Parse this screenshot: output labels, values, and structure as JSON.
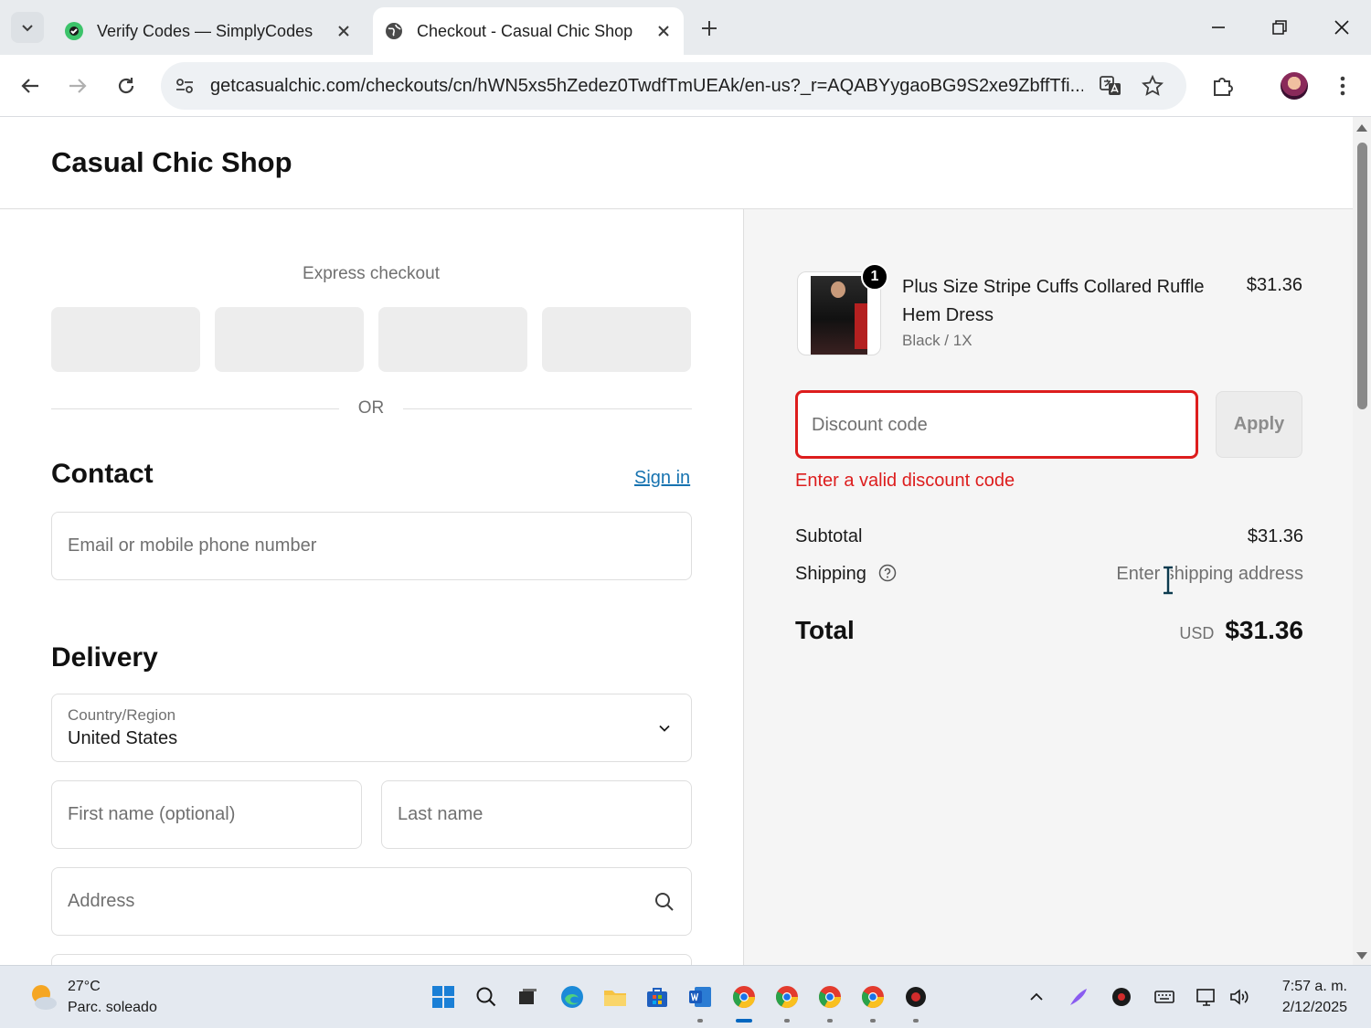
{
  "browser": {
    "tabs": [
      {
        "title": "Verify Codes — SimplyCodes",
        "active": false,
        "icon": "simplycodes-favicon"
      },
      {
        "title": "Checkout - Casual Chic Shop",
        "active": true,
        "icon": "globe-favicon"
      }
    ],
    "url": "getcasualchic.com/checkouts/cn/hWN5xs5hZedez0TwdfTmUEAk/en-us?_r=AQABYygaoBG9S2xe9ZbffTfi..."
  },
  "shop": {
    "name": "Casual Chic Shop"
  },
  "checkout": {
    "express_label": "Express checkout",
    "or_label": "OR",
    "contact": {
      "title": "Contact",
      "sign_in": "Sign in",
      "email_placeholder": "Email or mobile phone number"
    },
    "delivery": {
      "title": "Delivery",
      "country_label": "Country/Region",
      "country_value": "United States",
      "first_name_placeholder": "First name (optional)",
      "last_name_placeholder": "Last name",
      "address_placeholder": "Address"
    }
  },
  "summary": {
    "product": {
      "name": "Plus Size Stripe Cuffs Collared Ruffle Hem Dress",
      "variant": "Black / 1X",
      "price": "$31.36",
      "quantity": "1"
    },
    "discount_placeholder": "Discount code",
    "apply_label": "Apply",
    "discount_error": "Enter a valid discount code",
    "subtotal_label": "Subtotal",
    "subtotal_value": "$31.36",
    "shipping_label": "Shipping",
    "shipping_value": "Enter shipping address",
    "total_label": "Total",
    "currency": "USD",
    "total_value": "$31.36"
  },
  "taskbar": {
    "weather_temp": "27°C",
    "weather_desc": "Parc. soleado",
    "time": "7:57 a. m.",
    "date": "2/12/2025"
  },
  "colors": {
    "error": "#dd1d1d",
    "link": "#1773b0",
    "summary_bg": "#f5f5f5"
  }
}
